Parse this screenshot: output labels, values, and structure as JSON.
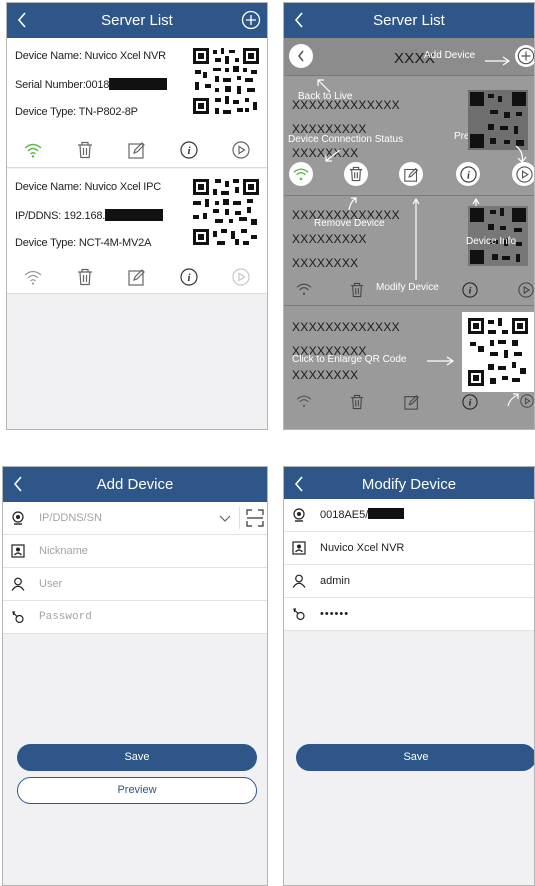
{
  "colors": {
    "header": "#2e5688",
    "wifi_active": "#5fb84a",
    "icon_gray": "#8a8a8a",
    "overlay": "#8a8a8a"
  },
  "server_list": {
    "title": "Server List",
    "icons": [
      "back-icon",
      "plus-circle-icon"
    ],
    "devices": [
      {
        "line1": "Device Name: Nuvico Xcel NVR",
        "line2": "Serial Number:0018",
        "line3": "Device Type: TN-P802-8P"
      },
      {
        "line1": "Device Name: Nuvico Xcel IPC",
        "line2": "IP/DDNS: 192.168.",
        "line3": "Device Type: NCT-4M-MV2A"
      }
    ],
    "action_icons": [
      "wifi-icon",
      "trash-icon",
      "edit-icon",
      "info-icon",
      "play-icon"
    ]
  },
  "annotated": {
    "title": "Server List",
    "xxx_top": "XXXX",
    "rows": [
      [
        "XXXXXXXXXXXXX",
        "XXXXXXXXX",
        "XXXXXXXX"
      ],
      [
        "XXXXXXXXXXXXX",
        "XXXXXXXXX",
        "XXXXXXXX"
      ],
      [
        "XXXXXXXXXXXXX",
        "XXXXXXXXX",
        "XXXXXXXX"
      ]
    ],
    "notes": {
      "add_device": "Add Device",
      "back_to_live": "Back to Live",
      "connection_status": "Device Connection Status",
      "preview_device": "Preview Device",
      "remove_device": "Remove Device",
      "device_info": "Device Info",
      "modify_device": "Modify Device",
      "enlarge_qr": "Click to Enlarge QR Code"
    }
  },
  "add_device": {
    "title": "Add Device",
    "fields": {
      "address_placeholder": "IP/DDNS/SN",
      "nickname_placeholder": "Nickname",
      "user_placeholder": "User",
      "password_placeholder": "Password"
    },
    "save_label": "Save",
    "preview_label": "Preview"
  },
  "modify_device": {
    "title": "Modify Device",
    "address_value": "0018AE5/",
    "nickname_value": "Nuvico Xcel NVR",
    "user_value": "admin",
    "password_value": "••••••",
    "save_label": "Save"
  }
}
